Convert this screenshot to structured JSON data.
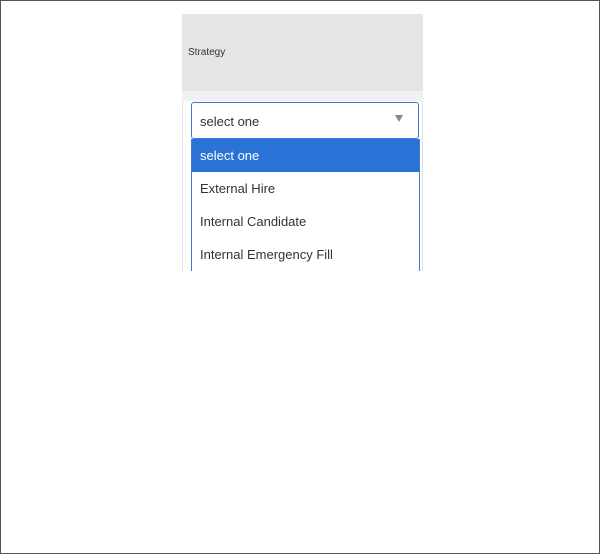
{
  "field": {
    "label": "Strategy"
  },
  "select": {
    "value": "select one",
    "arrow_icon": "triangle-down-icon"
  },
  "options": [
    {
      "label": "select one",
      "selected": true
    },
    {
      "label": "External Hire",
      "selected": false
    },
    {
      "label": "Internal Candidate",
      "selected": false
    },
    {
      "label": "Internal Emergency Fill",
      "selected": false
    }
  ],
  "colors": {
    "accent": "#2a73d6",
    "border_focus": "#3a7bd5",
    "header_bg": "#e4e5e6",
    "text": "#333333"
  }
}
